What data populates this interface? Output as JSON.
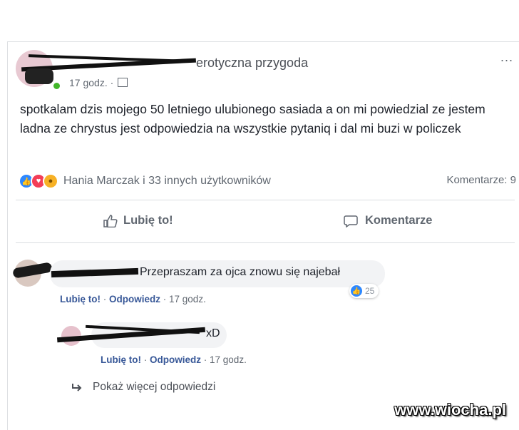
{
  "post": {
    "title": "erotyczna przygoda",
    "time": "17 godz. ·",
    "more": "...",
    "text": "spotkalam dzis mojego 50 letniego ulubionego sasiada a on mi powiedzial ze jestem ladna ze chrystus jest odpowiedzia na wszystkie pytaniq i dal mi buzi w policzek",
    "reactions_text": "Hania Marczak i 33 innych użytkowników",
    "comments_count": "Komentarze: 9"
  },
  "actions": {
    "like_label": "Lubię to!",
    "comment_label": "Komentarze"
  },
  "comments": [
    {
      "text": "Przepraszam za ojca znowu się najebał",
      "like": "Lubię to!",
      "reply": "Odpowiedz",
      "time": "· 17 godz.",
      "reactions": "25"
    },
    {
      "text": "xD",
      "like": "Lubię to!",
      "reply": "Odpowiedz",
      "time": "· 17 godz."
    }
  ],
  "more_replies": "Pokaż więcej odpowiedzi",
  "watermark": "www.wiocha.pl",
  "colors": {
    "like_blue": "#2d88ff",
    "love_red": "#f33e58",
    "online_green": "#42b72a",
    "link_blue": "#385898"
  }
}
